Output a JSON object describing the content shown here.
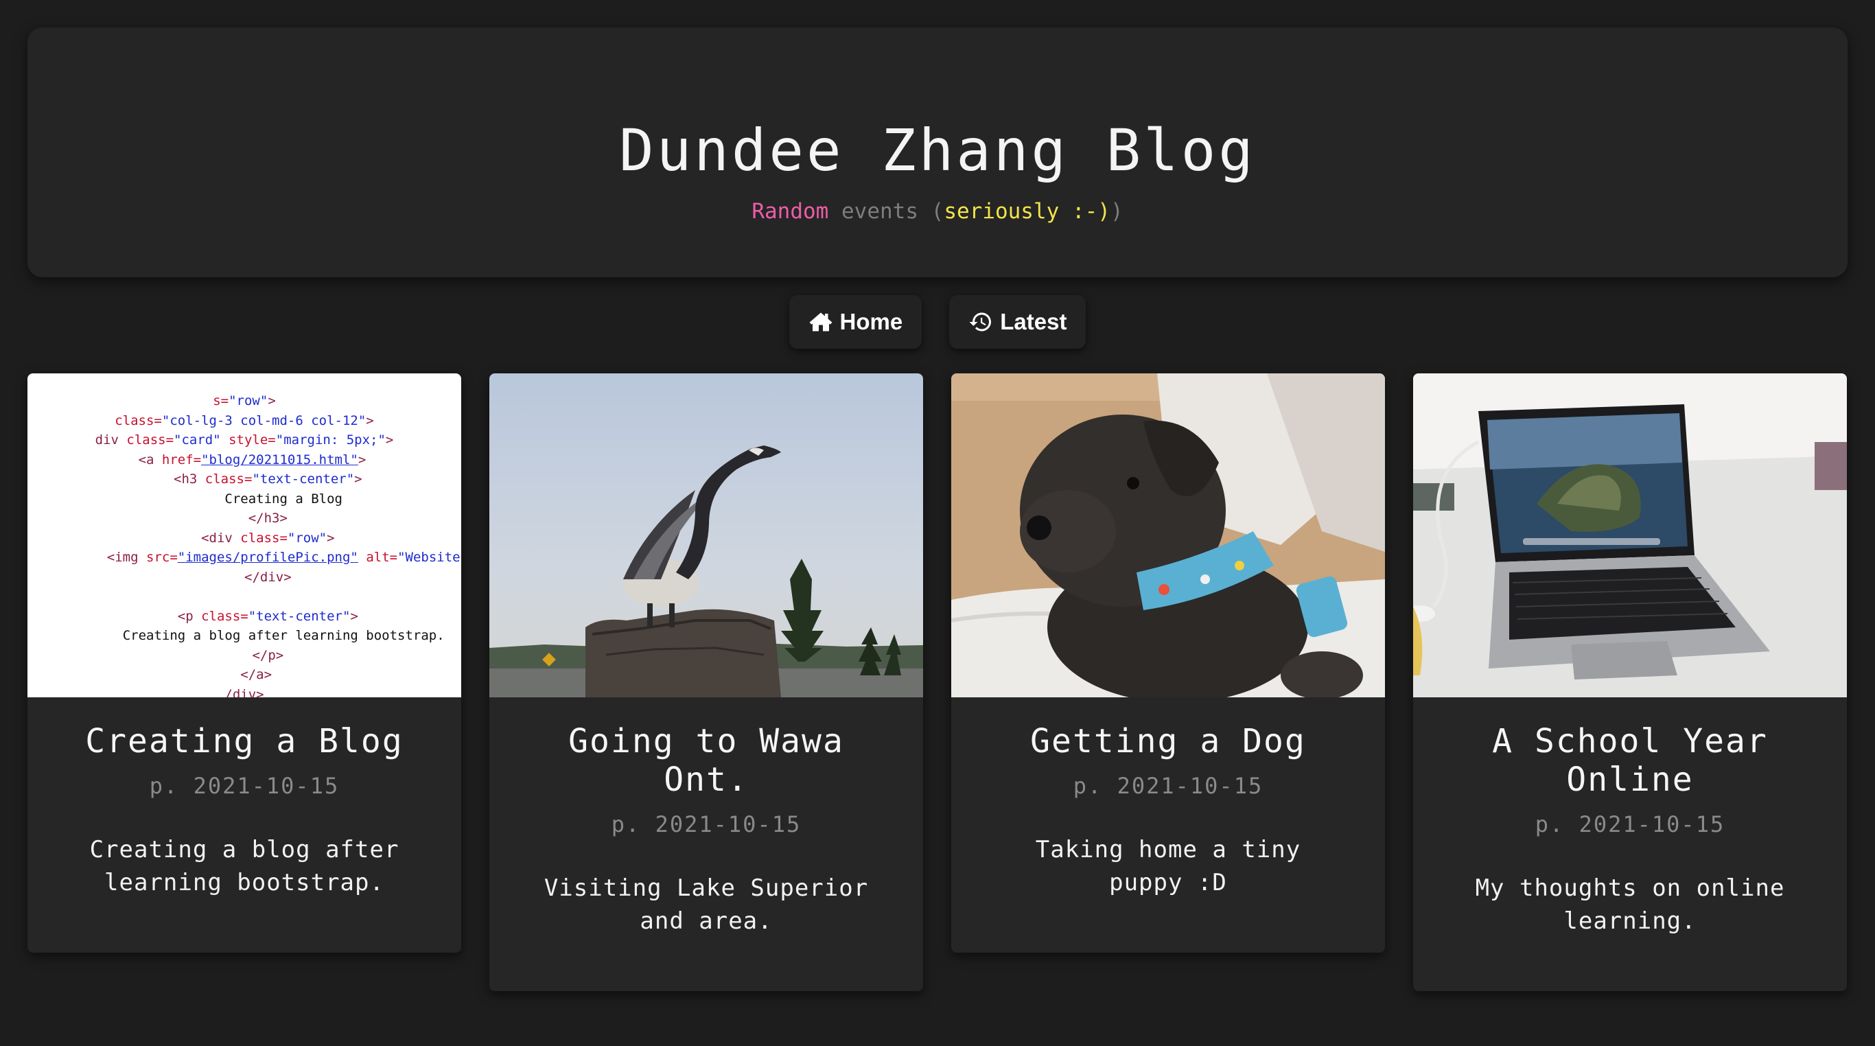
{
  "header": {
    "title": "Dundee Zhang Blog",
    "tagline": {
      "word1": "Random",
      "word2": " events ",
      "paren_open": "(",
      "word3": "seriously :-)",
      "paren_close": ")"
    }
  },
  "nav": {
    "home_label": "Home",
    "latest_label": "Latest"
  },
  "colors": {
    "background": "#1d1d1d",
    "card": "#262626",
    "tagline_pink": "#ec5ea8",
    "tagline_yellow": "#f2e44a"
  },
  "cards": [
    {
      "title": "Creating a Blog",
      "date": "p. 2021-10-15",
      "description": "Creating a blog after learning bootstrap.",
      "image": "code-screenshot",
      "code_lines": [
        {
          "indent": "",
          "parts": [
            [
              "a",
              "s="
            ],
            [
              "v",
              "\"row\""
            ],
            [
              "t",
              ">"
            ]
          ]
        },
        {
          "indent": "",
          "parts": [
            [
              "a",
              "class="
            ],
            [
              "v",
              "\"col-lg-3 col-md-6 col-12\""
            ],
            [
              "t",
              ">"
            ]
          ]
        },
        {
          "indent": "",
          "parts": [
            [
              "t",
              "div "
            ],
            [
              "a",
              "class="
            ],
            [
              "v",
              "\"card\" "
            ],
            [
              "a",
              "style="
            ],
            [
              "v",
              "\"margin: 5px;\""
            ],
            [
              "t",
              ">"
            ]
          ]
        },
        {
          "indent": "  ",
          "parts": [
            [
              "t",
              "<a "
            ],
            [
              "a",
              "href="
            ],
            [
              "u",
              "\"blog/20211015.html\""
            ],
            [
              "t",
              ">"
            ]
          ]
        },
        {
          "indent": "      ",
          "parts": [
            [
              "t",
              "<h3 "
            ],
            [
              "a",
              "class="
            ],
            [
              "v",
              "\"text-center\""
            ],
            [
              "t",
              ">"
            ]
          ]
        },
        {
          "indent": "          ",
          "parts": [
            [
              "x",
              "Creating a Blog"
            ]
          ]
        },
        {
          "indent": "      ",
          "parts": [
            [
              "t",
              "</h3>"
            ]
          ]
        },
        {
          "indent": "      ",
          "parts": [
            [
              "t",
              "<div "
            ],
            [
              "a",
              "class="
            ],
            [
              "v",
              "\"row\""
            ],
            [
              "t",
              ">"
            ]
          ]
        },
        {
          "indent": "          ",
          "parts": [
            [
              "t",
              "<img "
            ],
            [
              "a",
              "src="
            ],
            [
              "u",
              "\"images/profilePic.png\""
            ],
            [
              "a",
              " alt="
            ],
            [
              "v",
              "\"Website"
            ]
          ]
        },
        {
          "indent": "      ",
          "parts": [
            [
              "t",
              "</div>"
            ]
          ]
        },
        {
          "indent": "",
          "parts": [
            [
              "x",
              " "
            ]
          ]
        },
        {
          "indent": "      ",
          "parts": [
            [
              "t",
              "<p "
            ],
            [
              "a",
              "class="
            ],
            [
              "v",
              "\"text-center\""
            ],
            [
              "t",
              ">"
            ]
          ]
        },
        {
          "indent": "          ",
          "parts": [
            [
              "x",
              "Creating a blog after learning bootstrap."
            ]
          ]
        },
        {
          "indent": "      ",
          "parts": [
            [
              "t",
              "</p>"
            ]
          ]
        },
        {
          "indent": "   ",
          "parts": [
            [
              "t",
              "</a>"
            ]
          ]
        },
        {
          "indent": "",
          "parts": [
            [
              "t",
              "/div>"
            ]
          ]
        }
      ]
    },
    {
      "title": "Going to Wawa Ont.",
      "date": "p. 2021-10-15",
      "description": "Visiting Lake Superior and area.",
      "image": "goose-statue-photo"
    },
    {
      "title": "Getting a Dog",
      "date": "p. 2021-10-15",
      "description": "Taking home a tiny puppy :D",
      "image": "puppy-photo"
    },
    {
      "title": "A School Year Online",
      "date": "p. 2021-10-15",
      "description": "My thoughts on online learning.",
      "image": "laptop-photo"
    }
  ]
}
